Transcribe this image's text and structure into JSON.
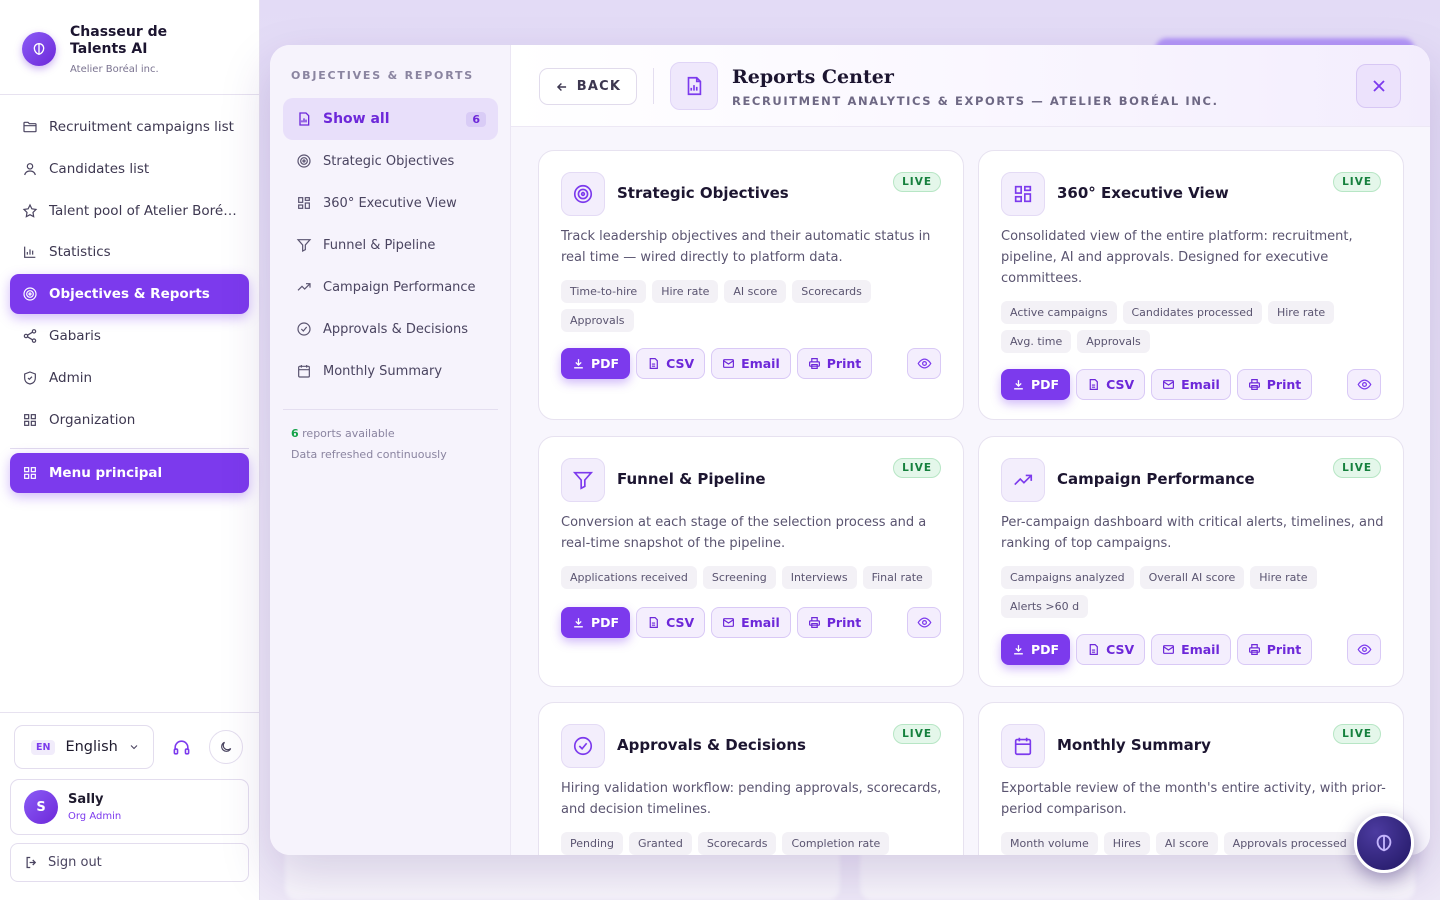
{
  "brand": {
    "title": "Chasseur de Talents AI",
    "subtitle": "Atelier Boréal inc."
  },
  "sidebar": {
    "items": [
      {
        "label": "Recruitment campaigns list",
        "icon": "folder-icon"
      },
      {
        "label": "Candidates list",
        "icon": "user-icon"
      },
      {
        "label": "Talent pool of Atelier Boré…",
        "icon": "star-icon"
      },
      {
        "label": "Statistics",
        "icon": "bar-chart-icon"
      },
      {
        "label": "Objectives & Reports",
        "icon": "target-icon",
        "active": true
      },
      {
        "label": "Gabaris",
        "icon": "share-icon"
      },
      {
        "label": "Admin",
        "icon": "shield-icon"
      },
      {
        "label": "Organization",
        "icon": "grid-icon"
      }
    ],
    "main_menu": "Menu principal",
    "language": {
      "code": "EN",
      "label": "English"
    },
    "user": {
      "initial": "S",
      "name": "Sally",
      "role": "Org Admin"
    },
    "sign_out": "Sign out"
  },
  "modal": {
    "nav_title": "OBJECTIVES & REPORTS",
    "nav_items": [
      {
        "label": "Show all",
        "count": "6",
        "active": true
      },
      {
        "label": "Strategic Objectives"
      },
      {
        "label": "360° Executive View"
      },
      {
        "label": "Funnel & Pipeline"
      },
      {
        "label": "Campaign Performance"
      },
      {
        "label": "Approvals & Decisions"
      },
      {
        "label": "Monthly Summary"
      }
    ],
    "footer_count": "6",
    "footer_available": "reports available",
    "footer_refresh": "Data refreshed continuously",
    "back_label": "BACK",
    "title": "Reports Center",
    "subtitle": "RECRUITMENT ANALYTICS & EXPORTS — ATELIER BORÉAL INC.",
    "live_label": "LIVE",
    "actions": {
      "pdf": "PDF",
      "csv": "CSV",
      "email": "Email",
      "print": "Print"
    },
    "cards": [
      {
        "title": "Strategic Objectives",
        "icon": "target-icon",
        "desc": "Track leadership objectives and their automatic status in real time — wired directly to platform data.",
        "tags": [
          "Time-to-hire",
          "Hire rate",
          "AI score",
          "Scorecards",
          "Approvals"
        ]
      },
      {
        "title": "360° Executive View",
        "icon": "grid-icon",
        "desc": "Consolidated view of the entire platform: recruitment, pipeline, AI and approvals. Designed for executive committees.",
        "tags": [
          "Active campaigns",
          "Candidates processed",
          "Hire rate",
          "Avg. time",
          "Approvals"
        ]
      },
      {
        "title": "Funnel & Pipeline",
        "icon": "funnel-icon",
        "desc": "Conversion at each stage of the selection process and a real-time snapshot of the pipeline.",
        "tags": [
          "Applications received",
          "Screening",
          "Interviews",
          "Final rate"
        ]
      },
      {
        "title": "Campaign Performance",
        "icon": "trending-up-icon",
        "desc": "Per-campaign dashboard with critical alerts, timelines, and ranking of top campaigns.",
        "tags": [
          "Campaigns analyzed",
          "Overall AI score",
          "Hire rate",
          "Alerts >60 d"
        ]
      },
      {
        "title": "Approvals & Decisions",
        "icon": "check-circle-icon",
        "desc": "Hiring validation workflow: pending approvals, scorecards, and decision timelines.",
        "tags": [
          "Pending",
          "Granted",
          "Scorecards",
          "Completion rate"
        ]
      },
      {
        "title": "Monthly Summary",
        "icon": "calendar-icon",
        "desc": "Exportable review of the month's entire activity, with prior-period comparison.",
        "tags": [
          "Month volume",
          "Hires",
          "AI score",
          "Approvals processed"
        ]
      }
    ]
  },
  "colors": {
    "accent": "#7c3aed",
    "live": "#15803d"
  }
}
